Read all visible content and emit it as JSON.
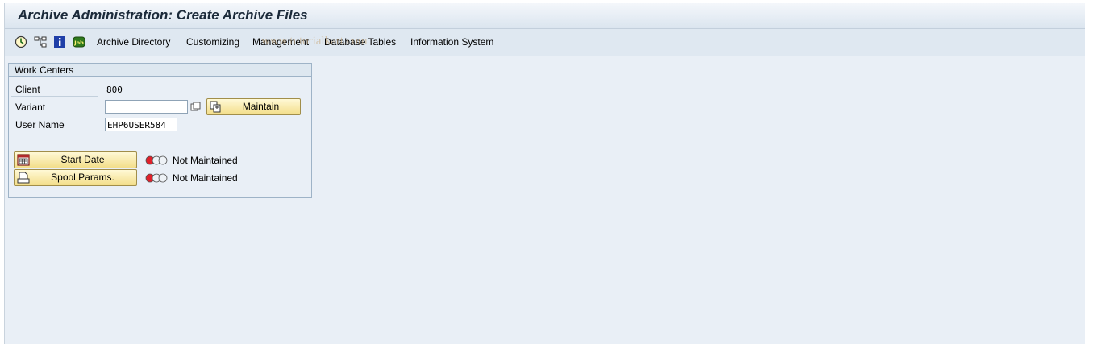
{
  "window": {
    "title": "Archive Administration: Create Archive Files"
  },
  "toolbar": {
    "icons": [
      "execute-clock-icon",
      "hierarchy-icon",
      "info-icon",
      "job-icon"
    ],
    "menu": [
      "Archive Directory",
      "Customizing",
      "Management",
      "Database Tables",
      "Information System"
    ],
    "watermark": "www.tutorialkart.com"
  },
  "work_centers": {
    "title": "Work Centers",
    "client_label": "Client",
    "client_value": "800",
    "variant_label": "Variant",
    "variant_value": "",
    "maintain_label": "Maintain",
    "user_label": "User Name",
    "user_value": "EHP6USER584",
    "start_date_label": "Start Date",
    "start_date_status": "Not Maintained",
    "spool_label": "Spool Params.",
    "spool_status": "Not Maintained"
  },
  "colors": {
    "button_fill": "#f3de8a",
    "light_red": "#e0202a",
    "background": "#e9eff6"
  }
}
